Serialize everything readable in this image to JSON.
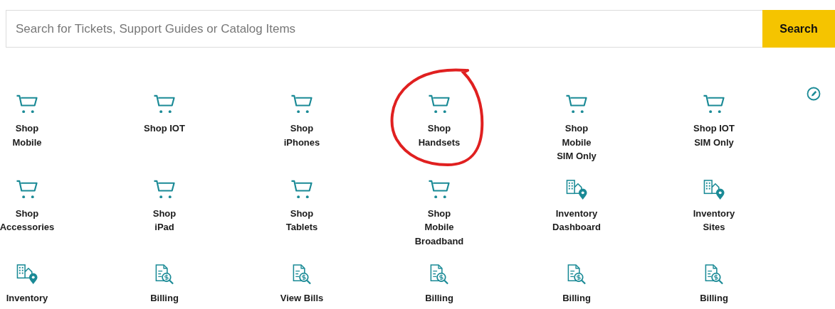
{
  "search": {
    "placeholder": "Search for Tickets, Support Guides or Catalog Items",
    "button": "Search"
  },
  "tiles": [
    {
      "kind": "cart",
      "lines": [
        "Shop",
        "Mobile"
      ]
    },
    {
      "kind": "cart",
      "lines": [
        "Shop IOT"
      ]
    },
    {
      "kind": "cart",
      "lines": [
        "Shop",
        "iPhones"
      ]
    },
    {
      "kind": "cart",
      "lines": [
        "Shop",
        "Handsets"
      ],
      "circled": true
    },
    {
      "kind": "cart",
      "lines": [
        "Shop",
        "Mobile",
        "SIM Only"
      ]
    },
    {
      "kind": "cart",
      "lines": [
        "Shop IOT",
        "SIM Only"
      ]
    },
    {
      "kind": "cart",
      "lines": [
        "Shop",
        "Accessories"
      ]
    },
    {
      "kind": "cart",
      "lines": [
        "Shop",
        "iPad"
      ]
    },
    {
      "kind": "cart",
      "lines": [
        "Shop",
        "Tablets"
      ]
    },
    {
      "kind": "cart",
      "lines": [
        "Shop",
        "Mobile",
        "Broadband"
      ]
    },
    {
      "kind": "building",
      "lines": [
        "Inventory",
        "Dashboard"
      ]
    },
    {
      "kind": "building",
      "lines": [
        "Inventory",
        "Sites"
      ]
    },
    {
      "kind": "building",
      "lines": [
        "Inventory"
      ]
    },
    {
      "kind": "bill",
      "lines": [
        "Billing"
      ]
    },
    {
      "kind": "bill",
      "lines": [
        "View Bills"
      ]
    },
    {
      "kind": "bill",
      "lines": [
        "Billing"
      ]
    },
    {
      "kind": "bill",
      "lines": [
        "Billing"
      ]
    },
    {
      "kind": "bill",
      "lines": [
        "Billing"
      ]
    }
  ]
}
